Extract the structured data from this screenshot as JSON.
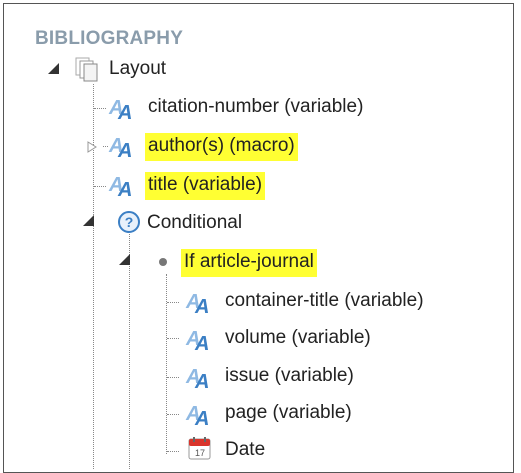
{
  "section_title": "BIBLIOGRAPHY",
  "tree": {
    "layout": {
      "label": "Layout",
      "icon": "layout-pages-icon"
    },
    "citation_number": {
      "label": "citation-number (variable)",
      "icon": "variable-text-icon"
    },
    "authors": {
      "label": "author(s) (macro)",
      "icon": "variable-text-icon",
      "highlighted": true
    },
    "title": {
      "label": "title (variable)",
      "icon": "variable-text-icon",
      "highlighted": true
    },
    "conditional": {
      "label": "Conditional",
      "icon": "question-circle-icon"
    },
    "if_article_journal": {
      "label": "If article-journal",
      "icon": "bullet-icon",
      "highlighted": true
    },
    "container_title": {
      "label": "container-title (variable)",
      "icon": "variable-text-icon"
    },
    "volume": {
      "label": "volume (variable)",
      "icon": "variable-text-icon"
    },
    "issue": {
      "label": "issue (variable)",
      "icon": "variable-text-icon"
    },
    "page": {
      "label": "page (variable)",
      "icon": "variable-text-icon"
    },
    "date": {
      "label": "Date",
      "icon": "calendar-icon",
      "date_number": "17"
    }
  },
  "colors": {
    "highlight": "#ffff33",
    "section_title": "#8a9cab",
    "icon_blue": "#3b7fc4",
    "calendar_red": "#d9342b"
  }
}
